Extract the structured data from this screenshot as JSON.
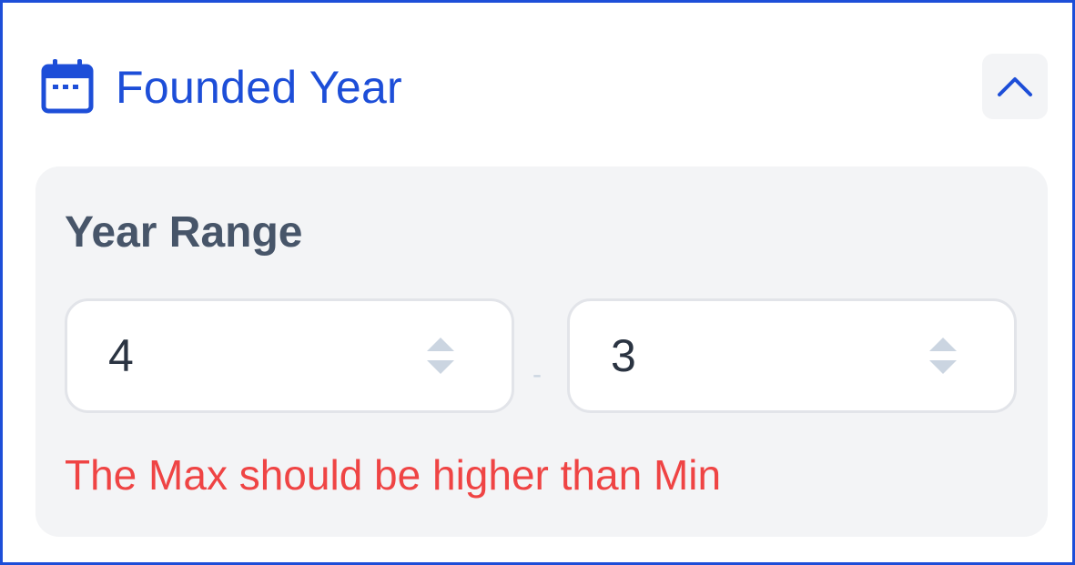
{
  "header": {
    "title": "Founded Year",
    "icon": "calendar-icon",
    "collapse_icon": "chevron-up-icon"
  },
  "range": {
    "label": "Year Range",
    "min_value": "4",
    "max_value": "3",
    "separator": "-",
    "spinner_icon": "up-down-arrows-icon"
  },
  "validation": {
    "error": "The Max should be higher than Min"
  },
  "colors": {
    "accent": "#1d4ed8",
    "error": "#ef4444",
    "label": "#475569",
    "card_bg": "#f3f4f6"
  }
}
